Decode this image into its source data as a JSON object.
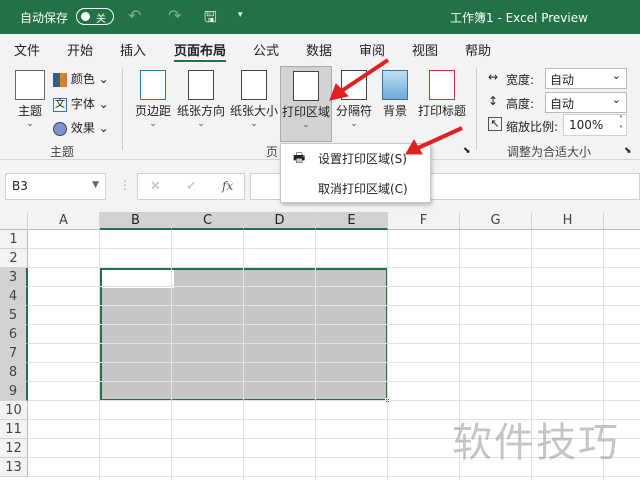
{
  "titlebar": {
    "autosave": "自动保存",
    "toggle": "关",
    "title": "工作簿1  -  Excel Preview",
    "color": "#217346"
  },
  "tabs": [
    "文件",
    "开始",
    "插入",
    "页面布局",
    "公式",
    "数据",
    "审阅",
    "视图",
    "帮助"
  ],
  "active_tab": "页面布局",
  "ribbon": {
    "theme": {
      "button": "主题",
      "colors": "颜色",
      "fonts": "字体",
      "effects": "效果",
      "group": "主题"
    },
    "page_setup": {
      "margins": "页边距",
      "orientation": "纸张方向",
      "size": "纸张大小",
      "print_area": "打印区域",
      "breaks": "分隔符",
      "background": "背景",
      "print_titles": "打印标题",
      "group_partial": "页"
    },
    "scale": {
      "width_label": "宽度:",
      "width_value": "自动",
      "height_label": "高度:",
      "height_value": "自动",
      "scale_label": "缩放比例:",
      "scale_value": "100%",
      "group": "调整为合适大小"
    }
  },
  "print_area_menu": {
    "items": [
      "设置打印区域(S)",
      "取消打印区域(C)"
    ]
  },
  "formula_bar": {
    "name_box": "B3",
    "cancel": "✕",
    "enter": "✓",
    "fx": "fx",
    "value": ""
  },
  "grid": {
    "columns": [
      "A",
      "B",
      "C",
      "D",
      "E",
      "F",
      "G",
      "H"
    ],
    "rows": [
      "1",
      "2",
      "3",
      "4",
      "5",
      "6",
      "7",
      "8",
      "9",
      "10",
      "11",
      "12",
      "13"
    ],
    "selection": "B3:E9",
    "selection_fill": "#c6c6c6"
  },
  "watermark": "软件技巧",
  "arrow_color": "#e02020"
}
